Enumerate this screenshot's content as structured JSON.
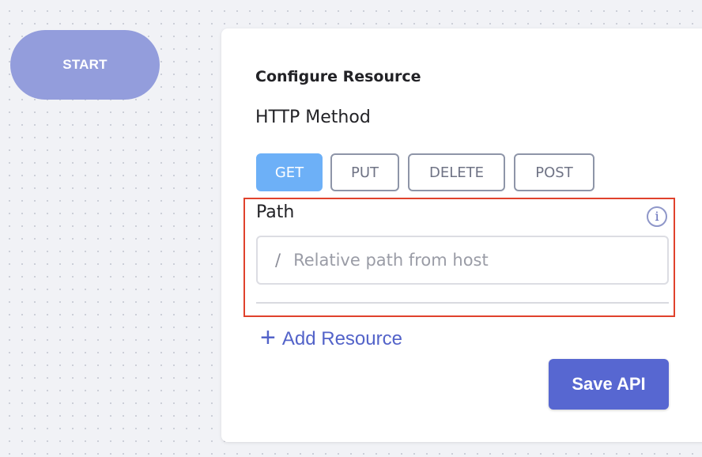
{
  "canvas": {
    "start_node_label": "START"
  },
  "panel": {
    "title": "Configure Resource",
    "http_method_label": "HTTP Method",
    "methods": [
      {
        "label": "GET",
        "active": true
      },
      {
        "label": "PUT",
        "active": false
      },
      {
        "label": "DELETE",
        "active": false
      },
      {
        "label": "POST",
        "active": false
      }
    ],
    "path": {
      "label": "Path",
      "info_icon": "i",
      "prefix": "/",
      "value": "",
      "placeholder": "Relative path from host"
    },
    "add_resource_icon": "+",
    "add_resource_label": "Add Resource",
    "save_label": "Save API"
  },
  "colors": {
    "active_method": "#6db0f7",
    "primary": "#5767d1",
    "start_node": "#939ddc",
    "highlight_border": "#e0422c"
  }
}
